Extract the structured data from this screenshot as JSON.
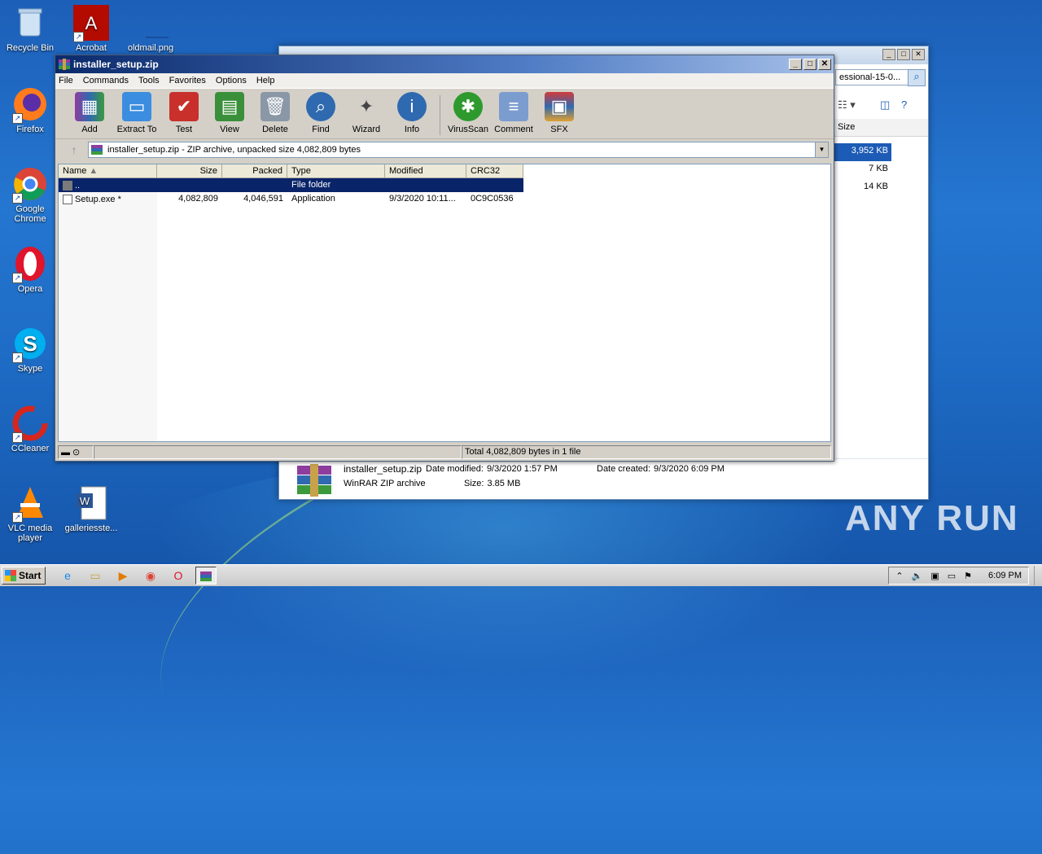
{
  "desktop": {
    "icons": [
      {
        "label": "Recycle Bin",
        "icon": "recycle-bin-icon"
      },
      {
        "label": "Acrobat",
        "icon": "acrobat-icon"
      },
      {
        "label": "oldmail.png",
        "icon": "image-file-icon"
      },
      {
        "label": "Firefox",
        "icon": "firefox-icon"
      },
      {
        "label": "Google Chrome",
        "icon": "chrome-icon"
      },
      {
        "label": "Opera",
        "icon": "opera-icon"
      },
      {
        "label": "Skype",
        "icon": "skype-icon"
      },
      {
        "label": "CCleaner",
        "icon": "ccleaner-icon"
      },
      {
        "label": "VLC media player",
        "icon": "vlc-icon"
      },
      {
        "label": "galleriesste...",
        "icon": "word-doc-icon"
      }
    ],
    "watermark": "ANY RUN"
  },
  "explorer_bg": {
    "address_partial": "essional-15-0...",
    "column_size": "Size",
    "sizes": [
      "3,952 KB",
      "7 KB",
      "14 KB"
    ],
    "details": {
      "filename": "installer_setup.zip",
      "date_modified_label": "Date modified:",
      "date_modified": "9/3/2020 1:57 PM",
      "date_created_label": "Date created:",
      "date_created": "9/3/2020 6:09 PM",
      "type": "WinRAR ZIP archive",
      "size_label": "Size:",
      "size": "3.85 MB"
    }
  },
  "winrar": {
    "title": "installer_setup.zip",
    "menu": [
      "File",
      "Commands",
      "Tools",
      "Favorites",
      "Options",
      "Help"
    ],
    "toolbar": [
      "Add",
      "Extract To",
      "Test",
      "View",
      "Delete",
      "Find",
      "Wizard",
      "Info",
      "VirusScan",
      "Comment",
      "SFX"
    ],
    "path": "installer_setup.zip - ZIP archive, unpacked size 4,082,809 bytes",
    "columns": [
      "Name",
      "Size",
      "Packed",
      "Type",
      "Modified",
      "CRC32"
    ],
    "rows": [
      {
        "name": "..",
        "size": "",
        "packed": "",
        "type": "File folder",
        "modified": "",
        "crc": ""
      },
      {
        "name": "Setup.exe *",
        "size": "4,082,809",
        "packed": "4,046,591",
        "type": "Application",
        "modified": "9/3/2020 10:11...",
        "crc": "0C9C0536"
      }
    ],
    "status": "Total 4,082,809 bytes in 1 file"
  },
  "taskbar": {
    "start_label": "Start",
    "clock": "6:09 PM"
  }
}
